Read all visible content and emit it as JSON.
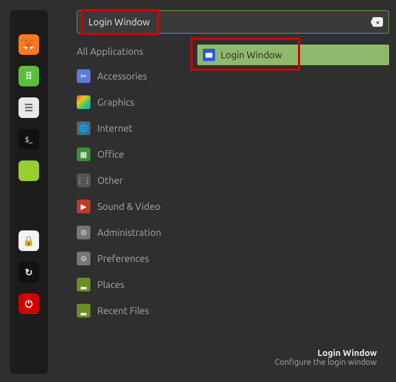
{
  "search": {
    "value": "Login Window"
  },
  "categories": [
    {
      "label": "All Applications",
      "icon": ""
    },
    {
      "label": "Accessories",
      "icon": "scissors"
    },
    {
      "label": "Graphics",
      "icon": "palette"
    },
    {
      "label": "Internet",
      "icon": "globe"
    },
    {
      "label": "Office",
      "icon": "office"
    },
    {
      "label": "Other",
      "icon": "grid"
    },
    {
      "label": "Sound & Video",
      "icon": "play"
    },
    {
      "label": "Administration",
      "icon": "gear"
    },
    {
      "label": "Preferences",
      "icon": "gear"
    },
    {
      "label": "Places",
      "icon": "folder"
    },
    {
      "label": "Recent Files",
      "icon": "folder"
    }
  ],
  "result": {
    "label": "Login Window"
  },
  "footer": {
    "title": "Login Window",
    "subtitle": "Configure the login window"
  },
  "panel": [
    {
      "name": "firefox",
      "bg": "#ff7a1a",
      "fg": "#fff",
      "glyph": "●"
    },
    {
      "name": "apps",
      "bg": "#5bbf3a",
      "fg": "#fff",
      "glyph": "⋮⋮"
    },
    {
      "name": "settings",
      "bg": "#e8e8e8",
      "fg": "#555",
      "glyph": "⚙"
    },
    {
      "name": "terminal",
      "bg": "#111",
      "fg": "#ccc",
      "glyph": ">_"
    },
    {
      "name": "files",
      "bg": "#9acd32",
      "fg": "#556b2f",
      "glyph": "▂"
    },
    {
      "name": "lock",
      "bg": "#f4f4f4",
      "fg": "#111",
      "glyph": "🔒"
    },
    {
      "name": "updates",
      "bg": "#111",
      "fg": "#eee",
      "glyph": "↻"
    },
    {
      "name": "power",
      "bg": "#d40000",
      "fg": "#fff",
      "glyph": "⏻"
    }
  ]
}
